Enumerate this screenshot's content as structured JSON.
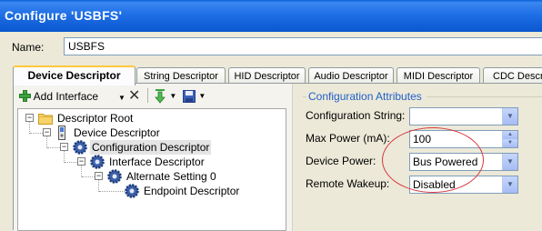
{
  "window": {
    "title": "Configure 'USBFS'"
  },
  "name_field": {
    "label": "Name:",
    "value": "USBFS"
  },
  "tabs": [
    {
      "label": "Device Descriptor",
      "active": true
    },
    {
      "label": "String Descriptor"
    },
    {
      "label": "HID Descriptor"
    },
    {
      "label": "Audio Descriptor"
    },
    {
      "label": "MIDI Descriptor"
    },
    {
      "label": "CDC Descri"
    }
  ],
  "toolbar": {
    "add_interface_label": "Add Interface",
    "icons": [
      "add-icon",
      "dropdown-arrow-icon",
      "delete-x-icon",
      "import-arrow-icon",
      "save-disk-icon"
    ]
  },
  "tree": {
    "nodes": [
      {
        "label": "Descriptor Root",
        "icon": "folder-icon",
        "expander": "−"
      },
      {
        "label": "Device Descriptor",
        "icon": "usb-device-icon",
        "expander": "−"
      },
      {
        "label": "Configuration Descriptor",
        "icon": "gear-icon",
        "expander": "−",
        "selected": true
      },
      {
        "label": "Interface Descriptor",
        "icon": "gear-icon",
        "expander": "−"
      },
      {
        "label": "Alternate Setting 0",
        "icon": "gear-icon",
        "expander": "−"
      },
      {
        "label": "Endpoint Descriptor",
        "icon": "gear-icon"
      }
    ]
  },
  "config_attributes": {
    "title": "Configuration Attributes",
    "configuration_string": {
      "label": "Configuration String:",
      "value": ""
    },
    "max_power": {
      "label": "Max Power (mA):",
      "value": "100"
    },
    "device_power": {
      "label": "Device Power:",
      "value": "Bus Powered"
    },
    "remote_wakeup": {
      "label": "Remote Wakeup:",
      "value": "Disabled"
    }
  },
  "colors": {
    "titlebar": "#0a5fd8",
    "group_title": "#1f5ec9",
    "annotation": "#d9363e",
    "active_tab_accent": "#ffc83c"
  }
}
